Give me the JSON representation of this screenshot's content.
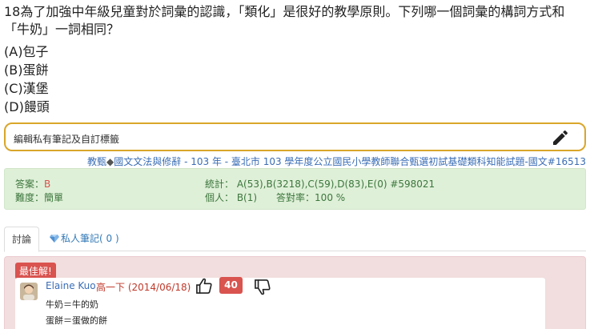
{
  "question": {
    "text": "18為了加強中年級兒童對於詞彙的認識，「類化」是很好的教學原則。下列哪一個詞彙的構詞方式和「牛奶」一詞相同？",
    "options": [
      "(A)包子",
      "(B)蛋餅",
      "(C)漢堡",
      "(D)饅頭"
    ]
  },
  "note_editor": {
    "placeholder": "編輯私有筆記及自訂標籤",
    "icon": "pencil-icon"
  },
  "tags": {
    "category": "教甄",
    "separator": "◆",
    "subject": "國文文法與修辭",
    "exam": " - 103 年 - 臺北市 103 學年度公立國民小學教師聯合甄選初試基礎類科知能試題-國文#16513"
  },
  "stats": {
    "answer_label": "答案：",
    "answer_value": "B",
    "difficulty": "難度：簡單",
    "statistics": "統計： A(53),B(3218),C(59),D(83),E(0) #598021",
    "personal": "個人： B(1)　　答對率：100 %"
  },
  "tabs": {
    "discussion": "討論",
    "private_notes": "私人筆記( 0 )"
  },
  "best_answer": {
    "badge": "最佳解!",
    "author": "Elaine Kuo",
    "meta": "高一下 (2014/06/18)",
    "votes": "40",
    "lines": [
      "牛奶＝牛的奶",
      "蛋餅＝蛋做的餅"
    ]
  },
  "colors": {
    "accent_border": "#d9a62a",
    "link": "#3a6db5",
    "success_bg": "#dff0d8",
    "danger": "#d9534f"
  }
}
